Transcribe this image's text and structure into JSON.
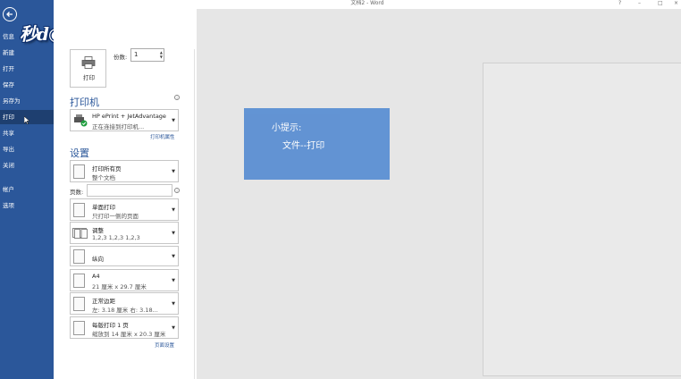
{
  "window": {
    "title": "文档2 - Word",
    "controls": [
      "?",
      "–",
      "□",
      "×"
    ]
  },
  "watermark": "秒d◉ng视频",
  "sidebar": {
    "back_icon": "back-arrow-icon",
    "items": [
      {
        "label": "信息"
      },
      {
        "label": "新建"
      },
      {
        "label": "打开"
      },
      {
        "label": "保存"
      },
      {
        "label": "另存为"
      },
      {
        "label": "打印"
      },
      {
        "label": "共享"
      },
      {
        "label": "导出"
      },
      {
        "label": "关闭"
      },
      {
        "label": "帐户"
      },
      {
        "label": "选项"
      }
    ]
  },
  "print": {
    "button_label": "打印",
    "copies_label": "份数:",
    "copies_value": "1"
  },
  "printer": {
    "heading": "打印机",
    "name": "HP ePrint + JetAdvantage",
    "status": "正在连接到打印机...",
    "properties_link": "打印机属性"
  },
  "settings": {
    "heading": "设置",
    "pages_label": "页数:",
    "page_setup_link": "页面设置",
    "options": [
      {
        "line1": "打印所有页",
        "line2": "整个文档"
      },
      {
        "line1": "单面打印",
        "line2": "只打印一侧的页面"
      },
      {
        "line1": "调整",
        "line2": "1,2,3    1,2,3    1,2,3"
      },
      {
        "line1": "纵向",
        "line2": ""
      },
      {
        "line1": "A4",
        "line2": "21 厘米 x 29.7 厘米"
      },
      {
        "line1": "正常边距",
        "line2": "左: 3.18 厘米    右: 3.18..."
      },
      {
        "line1": "每版打印 1 页",
        "line2": "缩放到 14 厘米 x 20.3 厘米"
      }
    ]
  },
  "tip": {
    "title": "小提示:",
    "body": "文件--打印"
  },
  "colors": {
    "sidebar": "#2b579a",
    "accent": "#2b579a",
    "tip_bg": "#5b8fd3"
  }
}
